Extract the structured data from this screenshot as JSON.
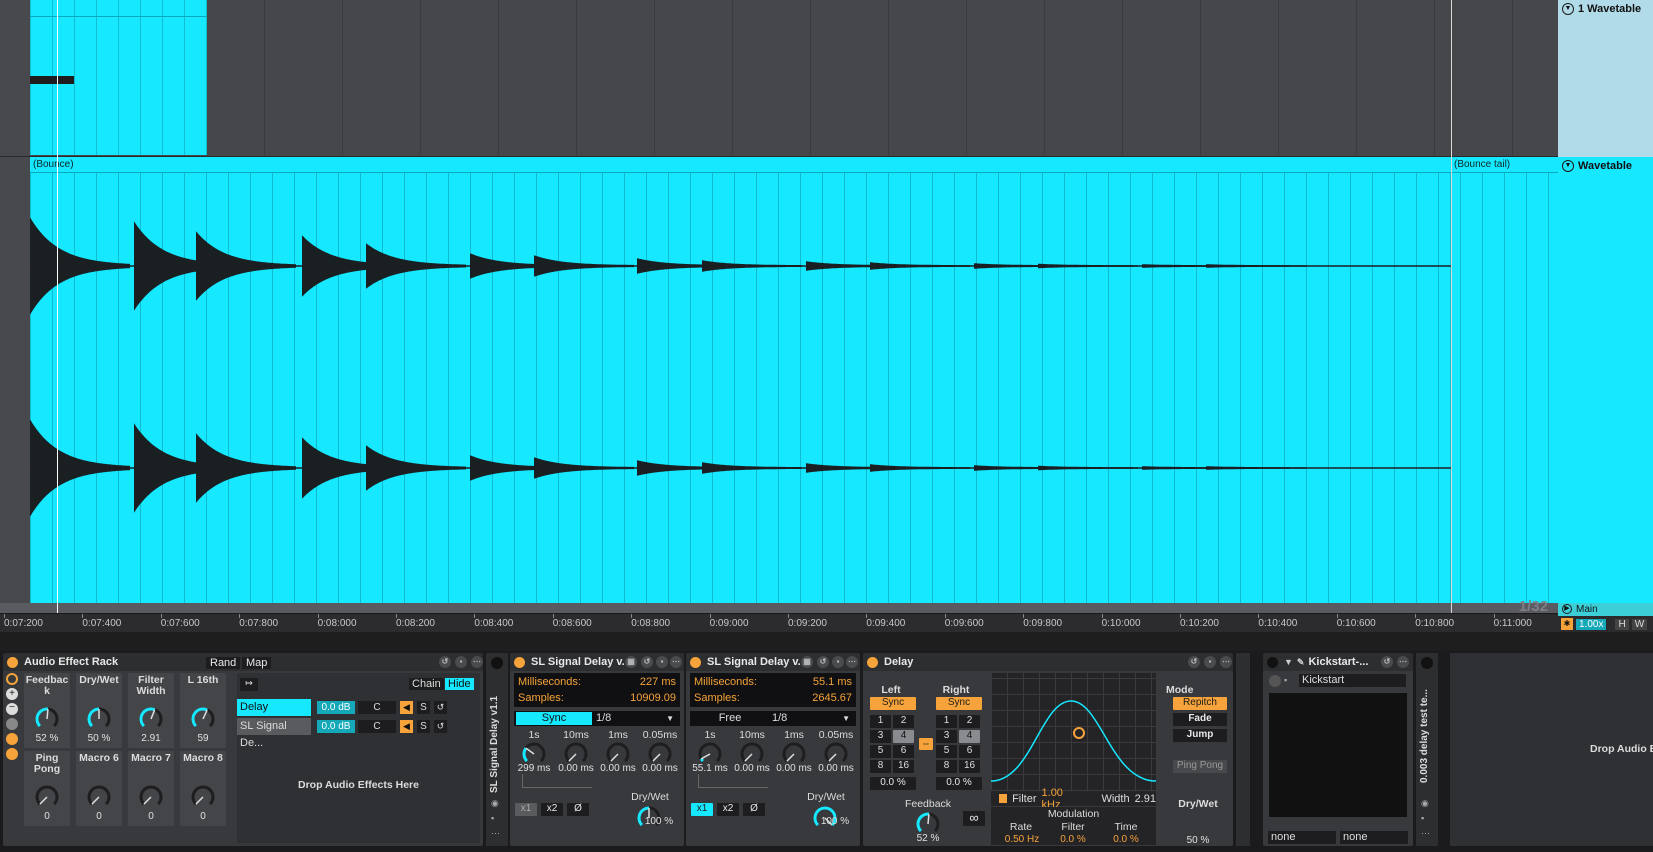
{
  "arrangement": {
    "clip_top_label": "",
    "bounce_label": "(Bounce)",
    "bounce_tail_label": "(Bounce tail)",
    "grid_quant": "1/32",
    "ruler_ticks": [
      "0:07:200",
      "0:07:400",
      "0:07:600",
      "0:07:800",
      "0:08:000",
      "0:08:200",
      "0:08:400",
      "0:08:600",
      "0:08:800",
      "0:09:000",
      "0:09:200",
      "0:09:400",
      "0:09:600",
      "0:09:800",
      "0:10:000",
      "0:10:200",
      "0:10:400",
      "0:10:600",
      "0:10:800",
      "0:11:000"
    ]
  },
  "tracks": {
    "track1": "1 Wavetable",
    "track2": "Wavetable",
    "main": "Main"
  },
  "zoom": {
    "value": "1.00x",
    "h": "H",
    "w": "W"
  },
  "audio_rack": {
    "title": "Audio Effect Rack",
    "rand": "Rand",
    "map": "Map",
    "macros": [
      {
        "name": "Feedbac k",
        "value": "52 %"
      },
      {
        "name": "Dry/Wet",
        "value": "50 %"
      },
      {
        "name": "Filter Width",
        "value": "2.91"
      },
      {
        "name": "L 16th",
        "value": "59"
      },
      {
        "name": "Ping Pong",
        "value": "0"
      },
      {
        "name": "Macro 6",
        "value": "0"
      },
      {
        "name": "Macro 7",
        "value": "0"
      },
      {
        "name": "Macro 8",
        "value": "0"
      }
    ],
    "chain_label": "Chain",
    "hide_label": "Hide",
    "chains": [
      {
        "name": "Delay",
        "vol": "0.0 dB",
        "pan": "C",
        "solo": "S"
      },
      {
        "name": "SL Signal De...",
        "vol": "0.0 dB",
        "pan": "C",
        "solo": "S"
      }
    ],
    "drop_text": "Drop Audio Effects Here",
    "side_label": "SL Signal Delay v1.1"
  },
  "sl_delay_1": {
    "title": "SL Signal Delay v...",
    "ms_label": "Milliseconds:",
    "ms_value": "227 ms",
    "samples_label": "Samples:",
    "samples_value": "10909.09",
    "mode": "Sync",
    "division": "1/8",
    "knob_labels": [
      "1s",
      "10ms",
      "1ms",
      "0.05ms"
    ],
    "knob_values": [
      "299 ms",
      "0.00 ms",
      "0.00 ms",
      "0.00 ms"
    ],
    "x1": "x1",
    "x2": "x2",
    "phase": "Ø",
    "drywet_label": "Dry/Wet",
    "drywet": "100 %"
  },
  "sl_delay_2": {
    "title": "SL Signal Delay v...",
    "ms_label": "Milliseconds:",
    "ms_value": "55.1 ms",
    "samples_label": "Samples:",
    "samples_value": "2645.67",
    "mode": "Free",
    "division": "1/8",
    "knob_labels": [
      "1s",
      "10ms",
      "1ms",
      "0.05ms"
    ],
    "knob_values": [
      "55.1 ms",
      "0.00 ms",
      "0.00 ms",
      "0.00 ms"
    ],
    "x1": "x1",
    "x2": "x2",
    "phase": "Ø",
    "drywet_label": "Dry/Wet",
    "drywet": "100 %"
  },
  "delay": {
    "title": "Delay",
    "left_label": "Left",
    "right_label": "Right",
    "sync": "Sync",
    "beats": [
      "1",
      "2",
      "3",
      "4",
      "5",
      "6",
      "8",
      "16"
    ],
    "left_offset": "0.0 %",
    "right_offset": "0.0 %",
    "feedback_label": "Feedback",
    "feedback": "52 %",
    "filter_label": "Filter",
    "filter_freq": "1.00 kHz",
    "width_label": "Width",
    "width": "2.91",
    "modulation_label": "Modulation",
    "rate_label": "Rate",
    "rate": "0.50 Hz",
    "mod_filter_label": "Filter",
    "mod_filter": "0.0 %",
    "time_label": "Time",
    "time": "0.0 %",
    "mode_label": "Mode",
    "modes": [
      "Repitch",
      "Fade",
      "Jump"
    ],
    "ping_pong": "Ping Pong",
    "drywet_label": "Dry/Wet",
    "drywet": "50 %"
  },
  "kickstart": {
    "title": "Kickstart-...",
    "preset": "Kickstart",
    "in1": "none",
    "in2": "none"
  },
  "side_clip_label": "0.003 delay test te...",
  "drop_right": "Drop Audio E"
}
